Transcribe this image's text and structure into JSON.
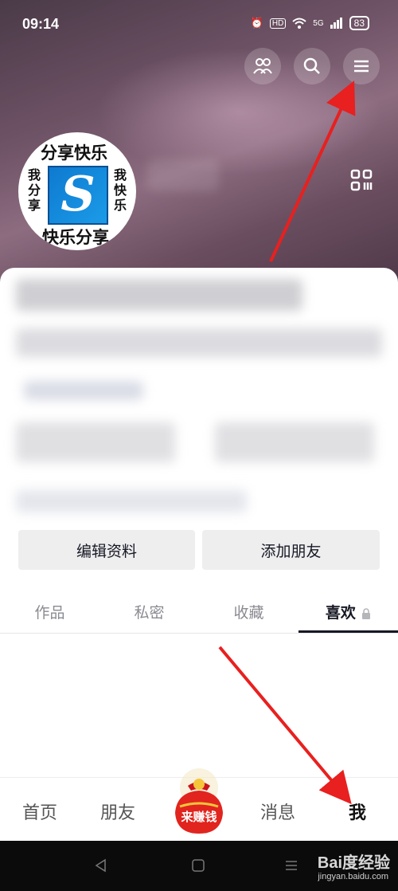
{
  "status_bar": {
    "time": "09:14",
    "network": "5G",
    "hd": "HD",
    "battery": "83"
  },
  "header": {
    "avatar_top_text": "分享快乐",
    "avatar_bottom_text": "快乐分享",
    "avatar_left_text": "我分享",
    "avatar_right_text": "我快乐",
    "avatar_center_letter": "S"
  },
  "actions": {
    "edit_profile": "编辑资料",
    "add_friends": "添加朋友"
  },
  "tabs": [
    {
      "label": "作品"
    },
    {
      "label": "私密"
    },
    {
      "label": "收藏"
    },
    {
      "label": "喜欢"
    }
  ],
  "bottom_nav": {
    "home": "首页",
    "friends": "朋友",
    "earn": "来赚钱",
    "messages": "消息",
    "me": "我"
  },
  "watermark": {
    "brand": "Bai度经验",
    "url": "jingyan.baidu.com"
  },
  "colors": {
    "annotation_arrow": "#e8201f",
    "active_text": "#161823"
  }
}
